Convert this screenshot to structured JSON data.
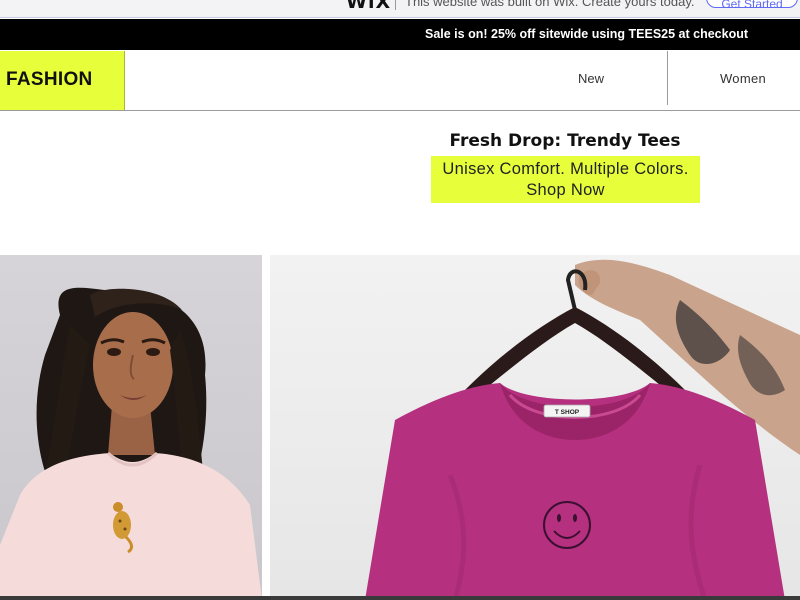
{
  "wix_banner": {
    "logo": "WiX",
    "text": "This website was built on Wix. Create yours today.",
    "cta": "Get Started"
  },
  "sale_bar": {
    "text": "Sale is on! 25% off sitewide using TEES25 at checkout"
  },
  "header": {
    "logo": "FASHION",
    "nav": [
      {
        "label": "New"
      },
      {
        "label": "Women"
      }
    ]
  },
  "hero": {
    "title": "Fresh Drop: Trendy Tees",
    "subtitle": "Unisex Comfort. Multiple Colors. Shop Now"
  },
  "images": {
    "left": {
      "icon": "woman-in-pink-tee-photo"
    },
    "right": {
      "icon": "magenta-tee-on-hanger-photo",
      "label_tag": "T SHOP"
    }
  },
  "colors": {
    "accent": "#e6ff3a",
    "sale_bar_bg": "#000000",
    "tee": "#b5307e"
  }
}
